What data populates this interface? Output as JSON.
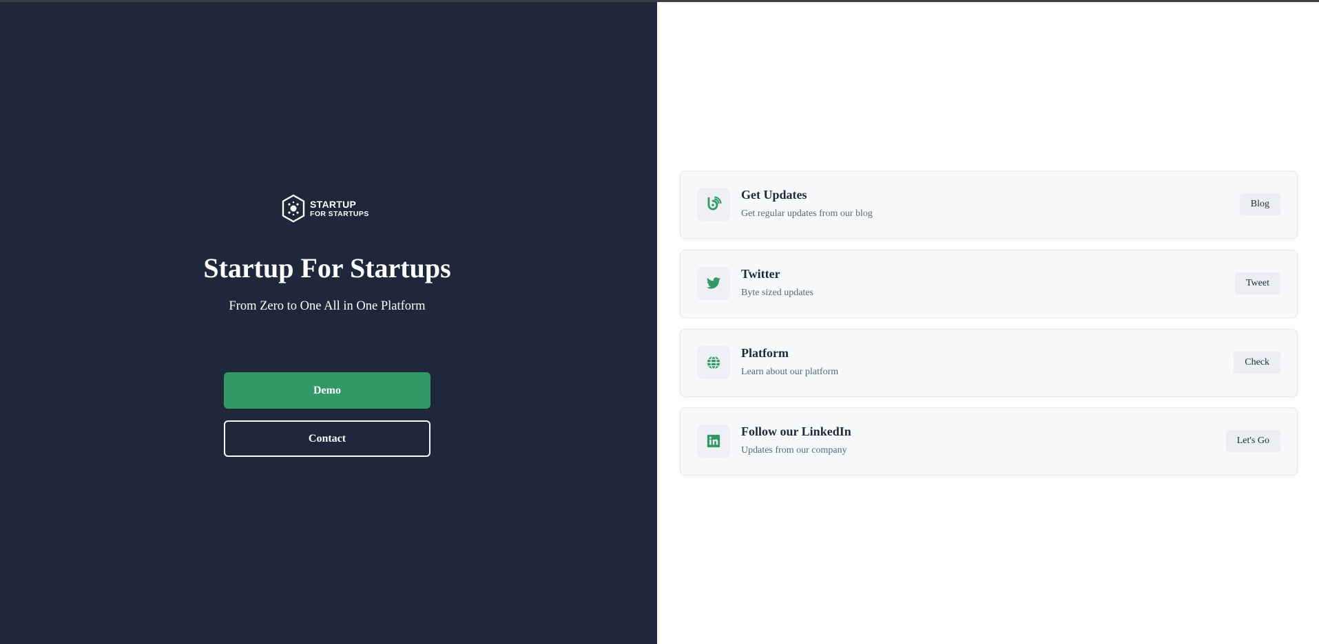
{
  "brand": {
    "logo_line1": "STARTUP",
    "logo_line2": "FOR STARTUPS"
  },
  "hero": {
    "title": "Startup For Startups",
    "subtitle": "From Zero to One All in One Platform"
  },
  "actions": {
    "demo_label": "Demo",
    "contact_label": "Contact"
  },
  "links": [
    {
      "title": "Get Updates",
      "description": "Get regular updates from our blog",
      "button": "Blog",
      "icon": "blog-icon"
    },
    {
      "title": "Twitter",
      "description": "Byte sized updates",
      "button": "Tweet",
      "icon": "twitter-icon"
    },
    {
      "title": "Platform",
      "description": "Learn about our platform",
      "button": "Check",
      "icon": "globe-icon"
    },
    {
      "title": "Follow our LinkedIn",
      "description": "Updates from our company",
      "button": "Let's Go",
      "icon": "linkedin-icon"
    }
  ],
  "colors": {
    "panel_bg": "#1f283b",
    "accent": "#309966",
    "card_bg": "#f8f9fb",
    "icon_box_bg": "#eef0f4"
  }
}
